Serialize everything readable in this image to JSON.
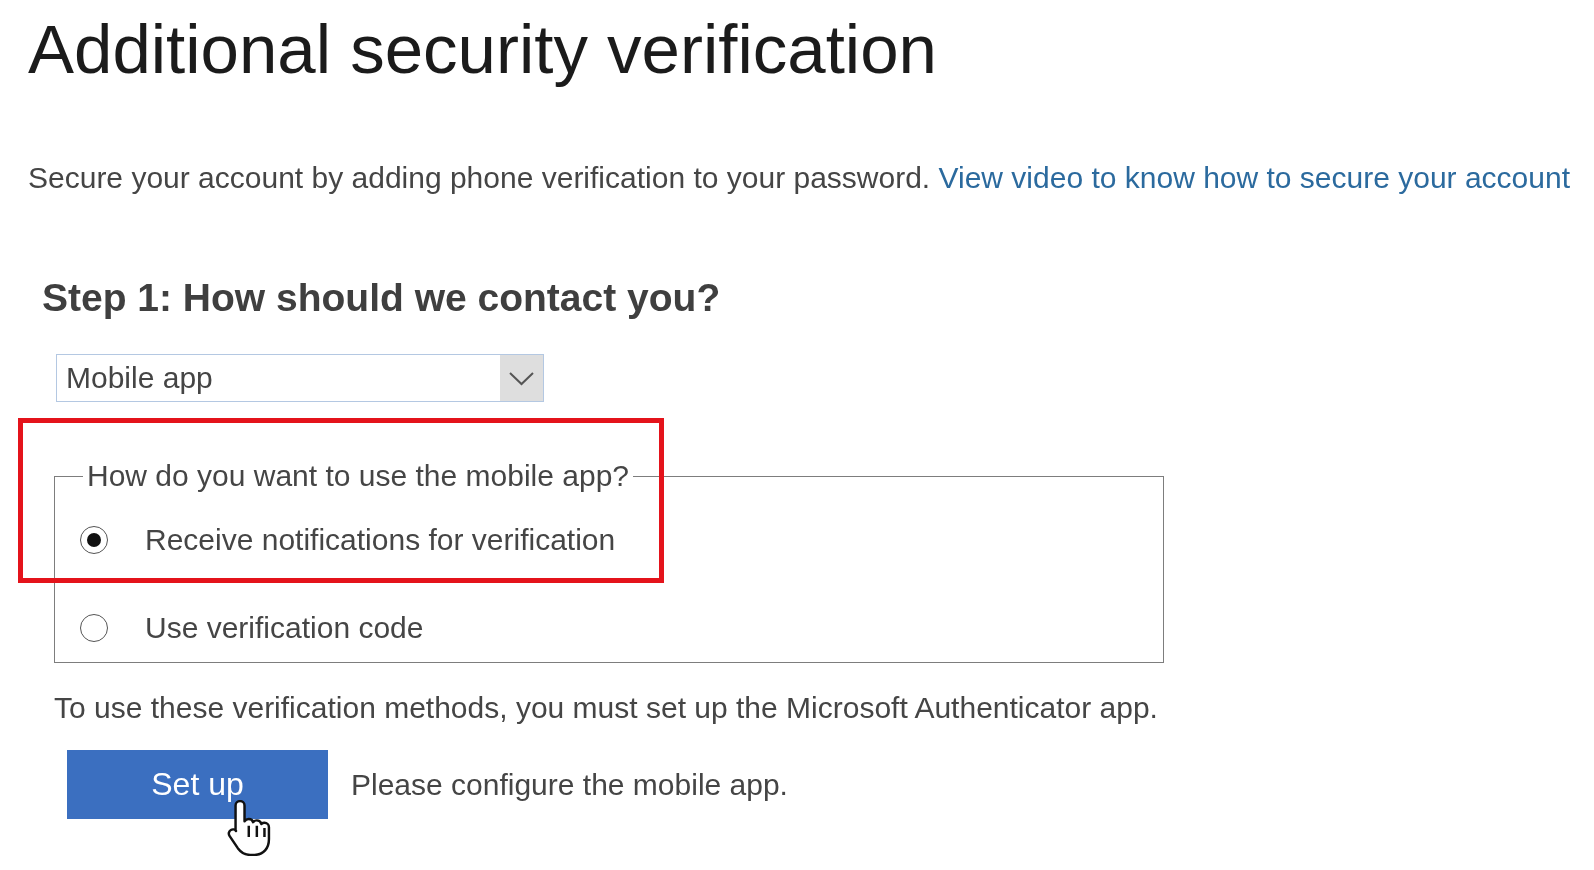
{
  "page": {
    "title": "Additional security verification"
  },
  "intro": {
    "text": "Secure your account by adding phone verification to your password.",
    "link": "View video to know how to secure your account"
  },
  "step": {
    "heading": "Step 1: How should we contact you?",
    "contact_method": {
      "value": "Mobile app"
    }
  },
  "mobile_app_options": {
    "legend": "How do you want to use the mobile app?",
    "options": [
      {
        "label": "Receive notifications for verification",
        "selected": true,
        "highlighted": true
      },
      {
        "label": "Use verification code",
        "selected": false,
        "highlighted": false
      }
    ]
  },
  "note": "To use these verification methods, you must set up the Microsoft Authenticator app.",
  "setup": {
    "button": "Set up",
    "status": "Please configure the mobile app."
  }
}
